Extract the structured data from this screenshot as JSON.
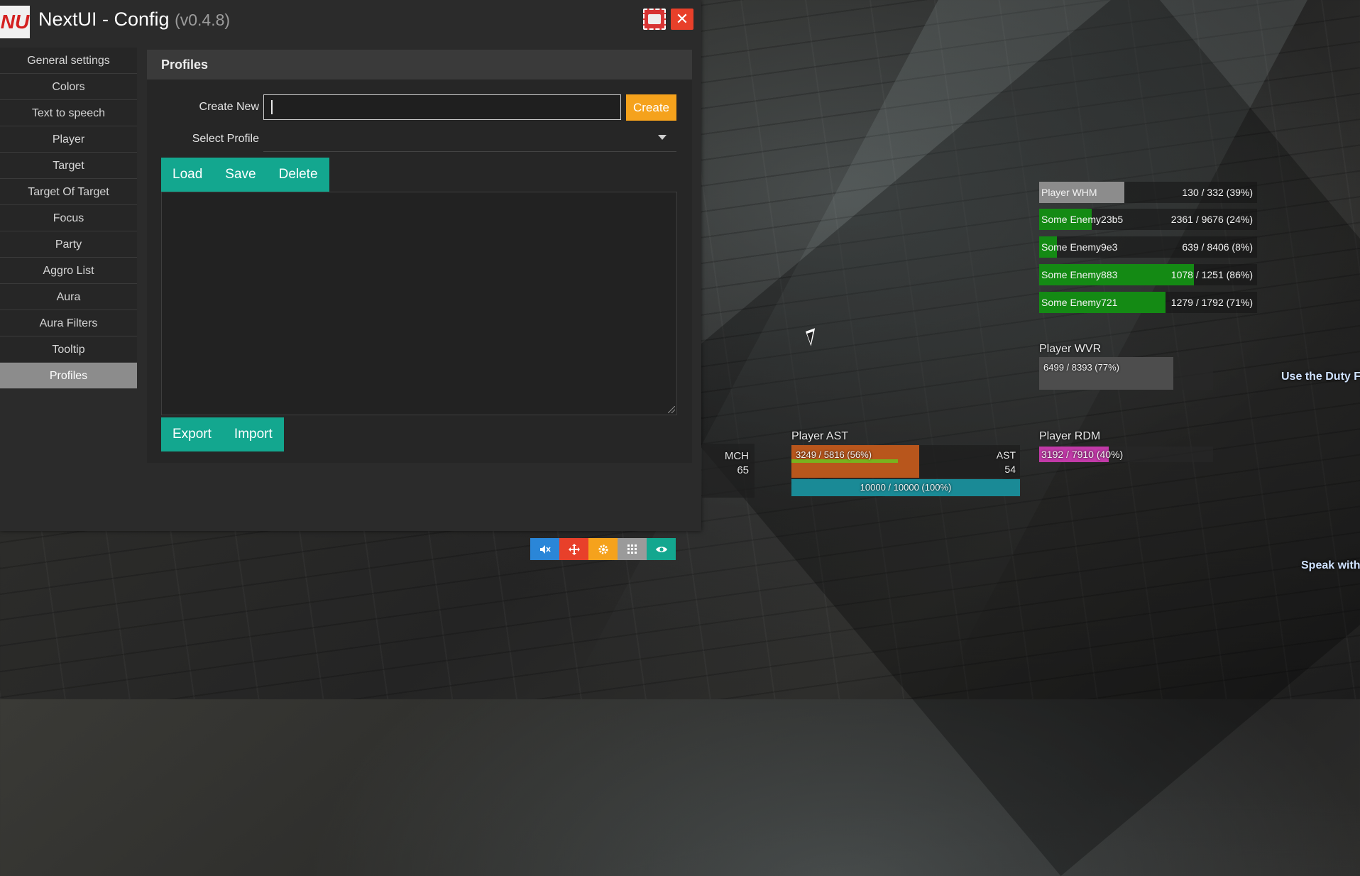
{
  "window": {
    "logo_text": "NU",
    "title": "NextUI - Config",
    "version": "(v0.4.8)",
    "close_label": "✕"
  },
  "sidebar": {
    "items": [
      {
        "label": "General settings"
      },
      {
        "label": "Colors"
      },
      {
        "label": "Text to speech"
      },
      {
        "label": "Player"
      },
      {
        "label": "Target"
      },
      {
        "label": "Target Of Target"
      },
      {
        "label": "Focus"
      },
      {
        "label": "Party"
      },
      {
        "label": "Aggro List"
      },
      {
        "label": "Aura"
      },
      {
        "label": "Aura Filters"
      },
      {
        "label": "Tooltip"
      },
      {
        "label": "Profiles"
      }
    ],
    "active": "Profiles"
  },
  "profiles": {
    "heading": "Profiles",
    "create_new_label": "Create New",
    "create_new_value": "",
    "create_button": "Create",
    "select_profile_label": "Select Profile",
    "select_profile_value": "",
    "load_button": "Load",
    "save_button": "Save",
    "delete_button": "Delete",
    "export_button": "Export",
    "import_button": "Import"
  },
  "hud": {
    "enmity_list": [
      {
        "name": "Player WHM",
        "value": "130 / 332 (39%)",
        "fill": 0.39,
        "color": "#8c8c8c"
      },
      {
        "name": "Some Enemy23b5",
        "value": "2361 / 9676 (24%)",
        "fill": 0.24,
        "color": "#148a14"
      },
      {
        "name": "Some Enemy9e3",
        "value": "639 / 8406 (8%)",
        "fill": 0.08,
        "color": "#148a14"
      },
      {
        "name": "Some Enemy883",
        "value": "1078 / 1251 (86%)",
        "fill": 0.86,
        "color": "#148a14"
      },
      {
        "name": "Some Enemy721",
        "value": "1279 / 1792 (71%)",
        "fill": 0.71,
        "color": "#148a14"
      }
    ],
    "player_wvr": {
      "name": "Player WVR",
      "hp": "6499 / 8393 (77%)",
      "fill": 0.77
    },
    "player_ast": {
      "name": "Player AST",
      "hp": "3249 / 5816 (56%)",
      "fill": 0.56,
      "mp": "10000 / 10000 (100%)",
      "mp_fill": 1.0,
      "job": "AST",
      "level": "54"
    },
    "player_mch": {
      "job": "MCH",
      "level": "65"
    },
    "player_rdm": {
      "name": "Player RDM",
      "hp": "3192 / 7910 (40%)",
      "fill": 0.4
    },
    "quest_1": "Use the Duty F",
    "quest_2": "Speak with"
  },
  "colors": {
    "accent_teal": "#13a78f",
    "accent_orange": "#f5a21c",
    "close_red": "#e8402a",
    "hp_orange": "#b8561c",
    "mp_teal": "#1a8a96",
    "rdm_magenta": "#c23aa8"
  }
}
